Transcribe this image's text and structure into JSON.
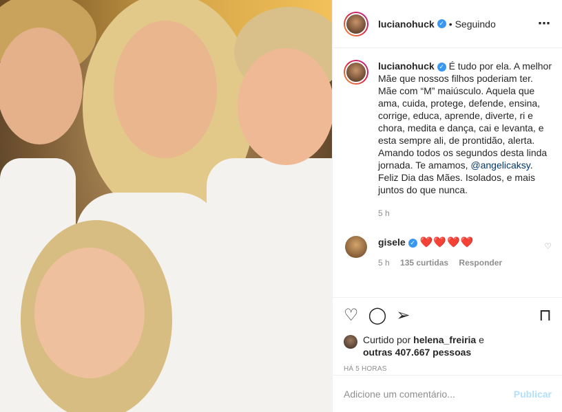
{
  "header": {
    "username": "lucianohuck",
    "separator": "•",
    "follow_status": "Seguindo",
    "more_icon": "⋯"
  },
  "caption": {
    "username": "lucianohuck",
    "text_before": " É tudo por ela. A melhor Mãe que nossos filhos poderiam ter. Mãe com “M” maiúsculo. Aquela que ama, cuida, protege, defende, ensina, corrige, educa, aprende, diverte, ri e chora, medita e dança, cai e levanta, e esta sempre ali, de prontidão, alerta. Amando todos os segundos desta linda jornada. Te amamos, ",
    "mention": "@angelicaksy",
    "text_after": ". Feliz Dia das Mães. Isolados, e mais juntos do que nunca.",
    "time": "5 h"
  },
  "reply": {
    "username": "gisele",
    "text": "❤️❤️❤️❤️",
    "time": "5 h",
    "likes": "135 curtidas",
    "reply_label": "Responder"
  },
  "likes": {
    "prefix": "Curtido por ",
    "user": "helena_freiria",
    "middle": " e",
    "count": "outras 407.667 pessoas"
  },
  "timestamp": "HÁ 5 HORAS",
  "comment_box": {
    "placeholder": "Adicione um comentário...",
    "publish": "Publicar"
  },
  "colors": {
    "verified": "#3897f0",
    "mention": "#00376b",
    "heart": "#e0245e",
    "publish_disabled": "#b2dffc"
  }
}
